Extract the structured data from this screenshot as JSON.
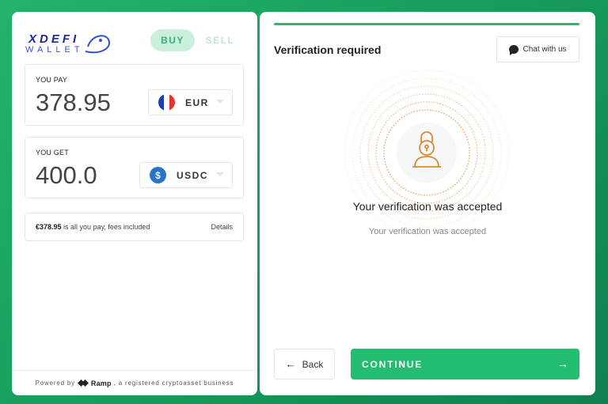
{
  "left": {
    "logo": {
      "line1": "XDEFI",
      "line2": "WALLET"
    },
    "toggle": {
      "buy": "BUY",
      "sell": "SELL"
    },
    "pay": {
      "label": "YOU PAY",
      "amount": "378.95",
      "currency": "EUR"
    },
    "get": {
      "label": "YOU GET",
      "amount": "400.0",
      "currency": "USDC"
    },
    "fee": {
      "amount": "€378.95",
      "text": " is all you pay, fees included",
      "details": "Details"
    },
    "footer": {
      "prefix": "Powered by",
      "brand": "Ramp",
      "suffix": ", a registered cryptoasset business"
    }
  },
  "right": {
    "title": "Verification required",
    "chat": "Chat with us",
    "message": "Your verification was accepted",
    "submessage": "Your verification was accepted",
    "back": "Back",
    "continue": "CONTINUE"
  },
  "colors": {
    "accent": "#23bd6f",
    "ring": "#e8a35a",
    "brand": "#1b2a8c"
  }
}
